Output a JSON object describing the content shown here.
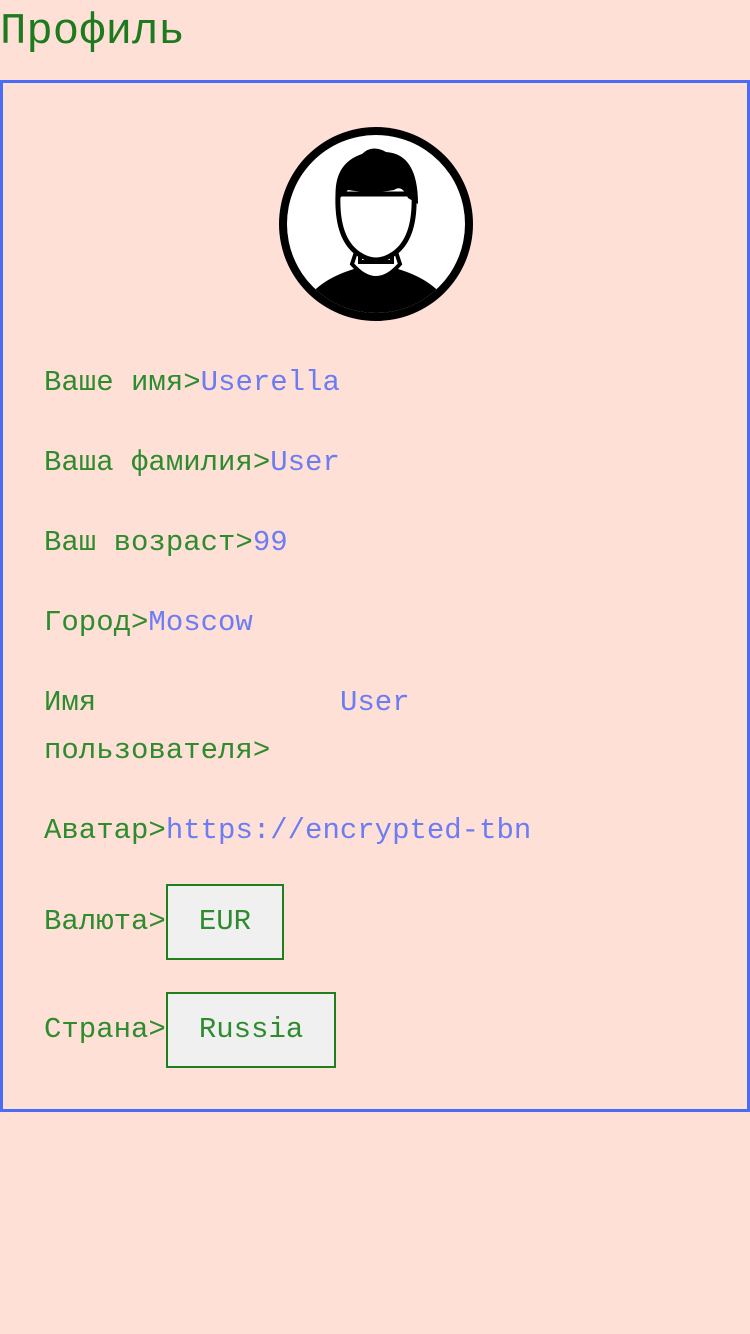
{
  "header": {
    "title": "Профиль"
  },
  "profile": {
    "avatar_icon": "user-avatar-icon",
    "first_name_label": "Ваше имя>",
    "first_name_value": "Userella",
    "last_name_label": "Ваша фамилия>",
    "last_name_value": "User",
    "age_label": "Ваш возраст>",
    "age_value": "99",
    "city_label": "Город>",
    "city_value": "Moscow",
    "username_label": "Имя пользователя>",
    "username_value": "User",
    "avatar_label": "Аватар>",
    "avatar_value": "https://encrypted-tbn",
    "currency_label": "Валюта>",
    "currency_value": "EUR",
    "country_label": "Страна>",
    "country_value": "Russia"
  },
  "colors": {
    "background": "#ffe0d6",
    "label": "#2e8b2e",
    "value": "#6b7cf5",
    "card_border": "#4a6cf7"
  }
}
